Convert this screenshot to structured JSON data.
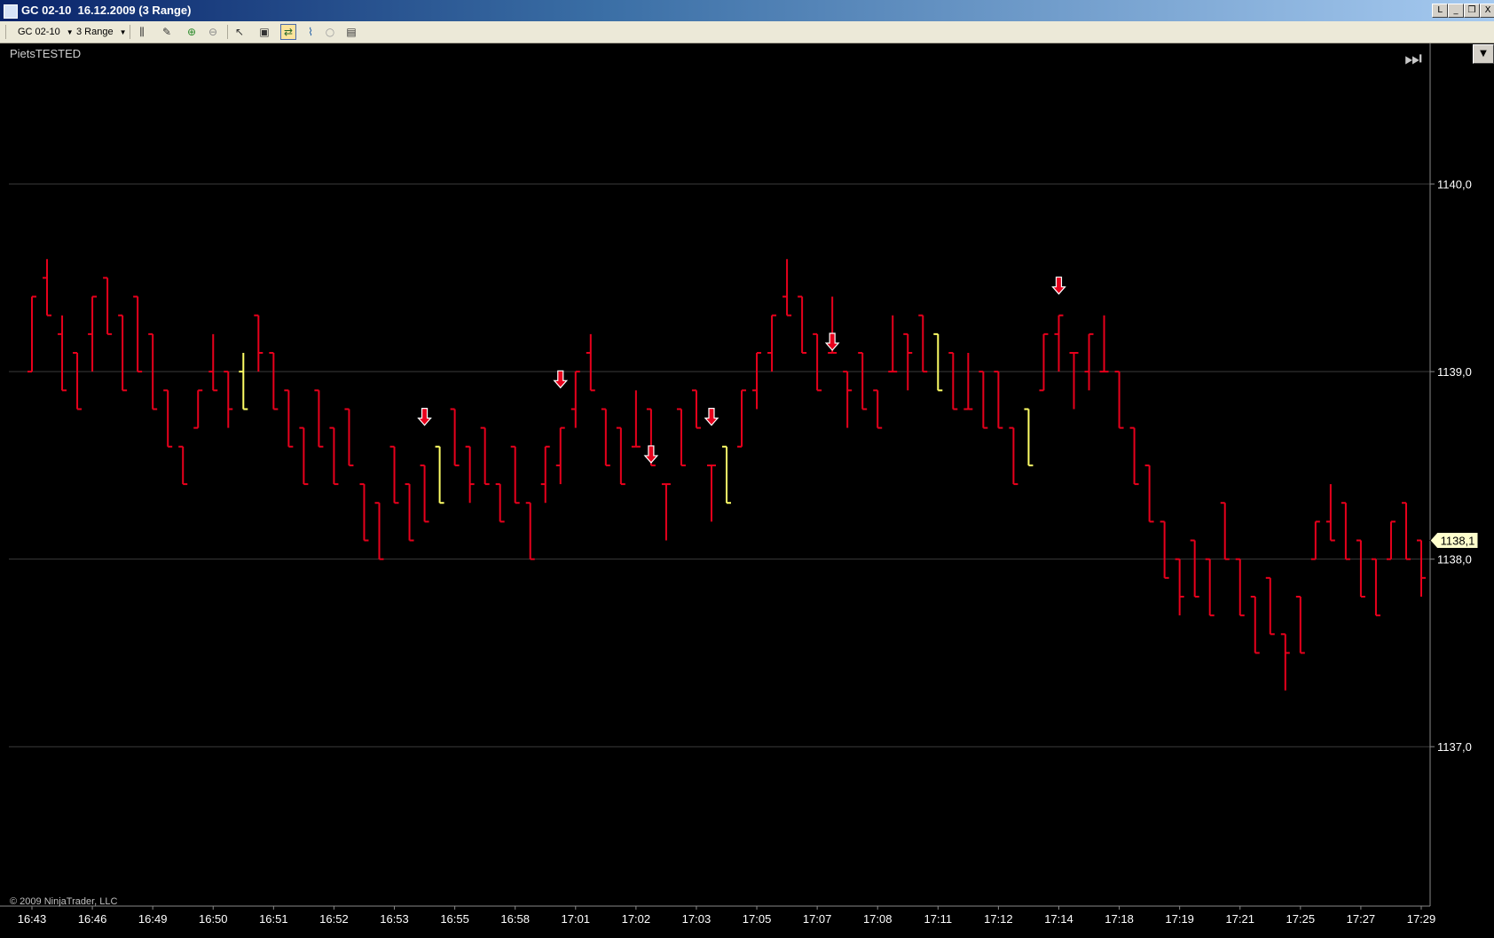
{
  "window": {
    "title": "GC 02-10  16.12.2009 (3 Range)",
    "buttons": [
      "L",
      "_",
      "❒",
      "X"
    ]
  },
  "toolbar": {
    "instrument": "GC 02-10",
    "interval": "3 Range",
    "icons": [
      "bar-style-icon",
      "drawing-tools-icon",
      "zoom-in-icon",
      "zoom-out-icon",
      "pointer-icon",
      "properties-icon",
      "strategies-icon",
      "indicators-icon",
      "data-box-icon",
      "chart-trader-icon"
    ]
  },
  "indicator_label": "PietsTESTED",
  "copyright": "© 2009 NinjaTrader, LLC",
  "colors": {
    "bar_down": "#e8001c",
    "bar_signal": "#ffff66",
    "grid": "#3a3a3a",
    "axis_text": "#ffffff",
    "price_marker_bg": "#ffffcc",
    "arrow_fill": "#e8001c"
  },
  "chart_data": {
    "type": "ohlc",
    "title": "",
    "xlabel": "",
    "ylabel": "",
    "ylim": [
      1136.15,
      1140.75
    ],
    "y_ticks": [
      1140.0,
      1139.0,
      1138.0,
      1137.0
    ],
    "y_tick_labels": [
      "1140,0",
      "1139,0",
      "1138,0",
      "1137,0"
    ],
    "last_price_label": "1138,1",
    "last_price": 1138.1,
    "x_tick_labels": [
      "16:43",
      "16:46",
      "16:49",
      "16:50",
      "16:51",
      "16:52",
      "16:53",
      "16:55",
      "16:58",
      "17:01",
      "17:02",
      "17:03",
      "17:05",
      "17:07",
      "17:08",
      "17:11",
      "17:12",
      "17:14",
      "17:18",
      "17:19",
      "17:21",
      "17:25",
      "17:27",
      "17:29"
    ],
    "grid": true,
    "bars": [
      {
        "o": 1139.0,
        "h": 1139.4,
        "l": 1139.0,
        "c": 1139.4,
        "color": "down"
      },
      {
        "o": 1139.5,
        "h": 1139.6,
        "l": 1139.3,
        "c": 1139.3,
        "color": "down"
      },
      {
        "o": 1139.2,
        "h": 1139.3,
        "l": 1138.9,
        "c": 1138.9,
        "color": "down"
      },
      {
        "o": 1139.1,
        "h": 1139.1,
        "l": 1138.8,
        "c": 1138.8,
        "color": "down"
      },
      {
        "o": 1139.2,
        "h": 1139.4,
        "l": 1139.0,
        "c": 1139.4,
        "color": "down"
      },
      {
        "o": 1139.5,
        "h": 1139.5,
        "l": 1139.2,
        "c": 1139.2,
        "color": "down"
      },
      {
        "o": 1139.3,
        "h": 1139.3,
        "l": 1138.9,
        "c": 1138.9,
        "color": "down"
      },
      {
        "o": 1139.4,
        "h": 1139.4,
        "l": 1139.0,
        "c": 1139.0,
        "color": "down"
      },
      {
        "o": 1139.2,
        "h": 1139.2,
        "l": 1138.8,
        "c": 1138.8,
        "color": "down"
      },
      {
        "o": 1138.9,
        "h": 1138.9,
        "l": 1138.6,
        "c": 1138.6,
        "color": "down"
      },
      {
        "o": 1138.6,
        "h": 1138.6,
        "l": 1138.4,
        "c": 1138.4,
        "color": "down"
      },
      {
        "o": 1138.7,
        "h": 1138.9,
        "l": 1138.7,
        "c": 1138.9,
        "color": "down"
      },
      {
        "o": 1139.0,
        "h": 1139.2,
        "l": 1138.9,
        "c": 1138.9,
        "color": "down"
      },
      {
        "o": 1139.0,
        "h": 1139.0,
        "l": 1138.7,
        "c": 1138.8,
        "color": "down"
      },
      {
        "o": 1139.0,
        "h": 1139.1,
        "l": 1138.8,
        "c": 1138.8,
        "color": "signal"
      },
      {
        "o": 1139.3,
        "h": 1139.3,
        "l": 1139.0,
        "c": 1139.1,
        "color": "down"
      },
      {
        "o": 1139.1,
        "h": 1139.1,
        "l": 1138.8,
        "c": 1138.8,
        "color": "down"
      },
      {
        "o": 1138.9,
        "h": 1138.9,
        "l": 1138.6,
        "c": 1138.6,
        "color": "down"
      },
      {
        "o": 1138.7,
        "h": 1138.7,
        "l": 1138.4,
        "c": 1138.4,
        "color": "down"
      },
      {
        "o": 1138.9,
        "h": 1138.9,
        "l": 1138.6,
        "c": 1138.6,
        "color": "down"
      },
      {
        "o": 1138.7,
        "h": 1138.7,
        "l": 1138.4,
        "c": 1138.4,
        "color": "down"
      },
      {
        "o": 1138.8,
        "h": 1138.8,
        "l": 1138.5,
        "c": 1138.5,
        "color": "down"
      },
      {
        "o": 1138.4,
        "h": 1138.4,
        "l": 1138.1,
        "c": 1138.1,
        "color": "down"
      },
      {
        "o": 1138.3,
        "h": 1138.3,
        "l": 1138.0,
        "c": 1138.0,
        "color": "down"
      },
      {
        "o": 1138.6,
        "h": 1138.6,
        "l": 1138.3,
        "c": 1138.3,
        "color": "down"
      },
      {
        "o": 1138.4,
        "h": 1138.4,
        "l": 1138.1,
        "c": 1138.1,
        "color": "down"
      },
      {
        "o": 1138.5,
        "h": 1138.5,
        "l": 1138.2,
        "c": 1138.2,
        "color": "down"
      },
      {
        "o": 1138.6,
        "h": 1138.6,
        "l": 1138.3,
        "c": 1138.3,
        "color": "signal"
      },
      {
        "o": 1138.8,
        "h": 1138.8,
        "l": 1138.5,
        "c": 1138.5,
        "color": "down"
      },
      {
        "o": 1138.6,
        "h": 1138.6,
        "l": 1138.3,
        "c": 1138.4,
        "color": "down"
      },
      {
        "o": 1138.7,
        "h": 1138.7,
        "l": 1138.4,
        "c": 1138.4,
        "color": "down"
      },
      {
        "o": 1138.4,
        "h": 1138.4,
        "l": 1138.2,
        "c": 1138.2,
        "color": "down"
      },
      {
        "o": 1138.6,
        "h": 1138.6,
        "l": 1138.3,
        "c": 1138.3,
        "color": "down"
      },
      {
        "o": 1138.3,
        "h": 1138.3,
        "l": 1138.0,
        "c": 1138.0,
        "color": "down"
      },
      {
        "o": 1138.4,
        "h": 1138.6,
        "l": 1138.3,
        "c": 1138.6,
        "color": "down"
      },
      {
        "o": 1138.5,
        "h": 1138.7,
        "l": 1138.4,
        "c": 1138.7,
        "color": "down"
      },
      {
        "o": 1138.8,
        "h": 1139.0,
        "l": 1138.7,
        "c": 1139.0,
        "color": "down"
      },
      {
        "o": 1139.1,
        "h": 1139.2,
        "l": 1138.9,
        "c": 1138.9,
        "color": "down"
      },
      {
        "o": 1138.8,
        "h": 1138.8,
        "l": 1138.5,
        "c": 1138.5,
        "color": "down"
      },
      {
        "o": 1138.7,
        "h": 1138.7,
        "l": 1138.4,
        "c": 1138.4,
        "color": "down"
      },
      {
        "o": 1138.6,
        "h": 1138.9,
        "l": 1138.6,
        "c": 1138.6,
        "color": "down"
      },
      {
        "o": 1138.8,
        "h": 1138.8,
        "l": 1138.5,
        "c": 1138.5,
        "color": "down"
      },
      {
        "o": 1138.4,
        "h": 1138.4,
        "l": 1138.1,
        "c": 1138.4,
        "color": "down"
      },
      {
        "o": 1138.8,
        "h": 1138.8,
        "l": 1138.5,
        "c": 1138.5,
        "color": "down"
      },
      {
        "o": 1138.9,
        "h": 1138.9,
        "l": 1138.7,
        "c": 1138.7,
        "color": "down"
      },
      {
        "o": 1138.5,
        "h": 1138.5,
        "l": 1138.2,
        "c": 1138.5,
        "color": "down"
      },
      {
        "o": 1138.6,
        "h": 1138.6,
        "l": 1138.3,
        "c": 1138.3,
        "color": "signal"
      },
      {
        "o": 1138.6,
        "h": 1138.9,
        "l": 1138.6,
        "c": 1138.9,
        "color": "down"
      },
      {
        "o": 1138.9,
        "h": 1139.1,
        "l": 1138.8,
        "c": 1139.1,
        "color": "down"
      },
      {
        "o": 1139.1,
        "h": 1139.3,
        "l": 1139.0,
        "c": 1139.3,
        "color": "down"
      },
      {
        "o": 1139.4,
        "h": 1139.6,
        "l": 1139.3,
        "c": 1139.3,
        "color": "down"
      },
      {
        "o": 1139.4,
        "h": 1139.4,
        "l": 1139.1,
        "c": 1139.1,
        "color": "down"
      },
      {
        "o": 1139.2,
        "h": 1139.2,
        "l": 1138.9,
        "c": 1138.9,
        "color": "down"
      },
      {
        "o": 1139.1,
        "h": 1139.4,
        "l": 1139.1,
        "c": 1139.1,
        "color": "down"
      },
      {
        "o": 1139.0,
        "h": 1139.0,
        "l": 1138.7,
        "c": 1138.9,
        "color": "down"
      },
      {
        "o": 1139.1,
        "h": 1139.1,
        "l": 1138.8,
        "c": 1138.8,
        "color": "down"
      },
      {
        "o": 1138.9,
        "h": 1138.9,
        "l": 1138.7,
        "c": 1138.7,
        "color": "down"
      },
      {
        "o": 1139.0,
        "h": 1139.3,
        "l": 1139.0,
        "c": 1139.0,
        "color": "down"
      },
      {
        "o": 1139.2,
        "h": 1139.2,
        "l": 1138.9,
        "c": 1139.1,
        "color": "down"
      },
      {
        "o": 1139.3,
        "h": 1139.3,
        "l": 1139.0,
        "c": 1139.0,
        "color": "down"
      },
      {
        "o": 1139.2,
        "h": 1139.2,
        "l": 1138.9,
        "c": 1138.9,
        "color": "signal"
      },
      {
        "o": 1139.1,
        "h": 1139.1,
        "l": 1138.8,
        "c": 1138.8,
        "color": "down"
      },
      {
        "o": 1138.8,
        "h": 1139.1,
        "l": 1138.8,
        "c": 1138.8,
        "color": "down"
      },
      {
        "o": 1139.0,
        "h": 1139.0,
        "l": 1138.7,
        "c": 1138.7,
        "color": "down"
      },
      {
        "o": 1139.0,
        "h": 1139.0,
        "l": 1138.7,
        "c": 1138.7,
        "color": "down"
      },
      {
        "o": 1138.7,
        "h": 1138.7,
        "l": 1138.4,
        "c": 1138.4,
        "color": "down"
      },
      {
        "o": 1138.8,
        "h": 1138.8,
        "l": 1138.5,
        "c": 1138.5,
        "color": "signal"
      },
      {
        "o": 1138.9,
        "h": 1139.2,
        "l": 1138.9,
        "c": 1139.2,
        "color": "down"
      },
      {
        "o": 1139.2,
        "h": 1139.3,
        "l": 1139.0,
        "c": 1139.3,
        "color": "down"
      },
      {
        "o": 1139.1,
        "h": 1139.1,
        "l": 1138.8,
        "c": 1139.1,
        "color": "down"
      },
      {
        "o": 1139.0,
        "h": 1139.2,
        "l": 1138.9,
        "c": 1139.2,
        "color": "down"
      },
      {
        "o": 1139.0,
        "h": 1139.3,
        "l": 1139.0,
        "c": 1139.0,
        "color": "down"
      },
      {
        "o": 1139.0,
        "h": 1139.0,
        "l": 1138.7,
        "c": 1138.7,
        "color": "down"
      },
      {
        "o": 1138.7,
        "h": 1138.7,
        "l": 1138.4,
        "c": 1138.4,
        "color": "down"
      },
      {
        "o": 1138.5,
        "h": 1138.5,
        "l": 1138.2,
        "c": 1138.2,
        "color": "down"
      },
      {
        "o": 1138.2,
        "h": 1138.2,
        "l": 1137.9,
        "c": 1137.9,
        "color": "down"
      },
      {
        "o": 1138.0,
        "h": 1138.0,
        "l": 1137.7,
        "c": 1137.8,
        "color": "down"
      },
      {
        "o": 1138.1,
        "h": 1138.1,
        "l": 1137.8,
        "c": 1137.8,
        "color": "down"
      },
      {
        "o": 1138.0,
        "h": 1138.0,
        "l": 1137.7,
        "c": 1137.7,
        "color": "down"
      },
      {
        "o": 1138.3,
        "h": 1138.3,
        "l": 1138.0,
        "c": 1138.0,
        "color": "down"
      },
      {
        "o": 1138.0,
        "h": 1138.0,
        "l": 1137.7,
        "c": 1137.7,
        "color": "down"
      },
      {
        "o": 1137.8,
        "h": 1137.8,
        "l": 1137.5,
        "c": 1137.5,
        "color": "down"
      },
      {
        "o": 1137.9,
        "h": 1137.9,
        "l": 1137.6,
        "c": 1137.6,
        "color": "down"
      },
      {
        "o": 1137.6,
        "h": 1137.6,
        "l": 1137.3,
        "c": 1137.5,
        "color": "down"
      },
      {
        "o": 1137.8,
        "h": 1137.8,
        "l": 1137.5,
        "c": 1137.5,
        "color": "down"
      },
      {
        "o": 1138.0,
        "h": 1138.2,
        "l": 1138.0,
        "c": 1138.2,
        "color": "down"
      },
      {
        "o": 1138.2,
        "h": 1138.4,
        "l": 1138.1,
        "c": 1138.1,
        "color": "down"
      },
      {
        "o": 1138.3,
        "h": 1138.3,
        "l": 1138.0,
        "c": 1138.0,
        "color": "down"
      },
      {
        "o": 1138.1,
        "h": 1138.1,
        "l": 1137.8,
        "c": 1137.8,
        "color": "down"
      },
      {
        "o": 1138.0,
        "h": 1138.0,
        "l": 1137.7,
        "c": 1137.7,
        "color": "down"
      },
      {
        "o": 1138.0,
        "h": 1138.2,
        "l": 1138.0,
        "c": 1138.2,
        "color": "down"
      },
      {
        "o": 1138.3,
        "h": 1138.3,
        "l": 1138.0,
        "c": 1138.0,
        "color": "down"
      },
      {
        "o": 1138.1,
        "h": 1138.1,
        "l": 1137.8,
        "c": 1137.9,
        "color": "down"
      }
    ],
    "short_signals": [
      {
        "bar": 26,
        "price": 1138.7
      },
      {
        "bar": 35,
        "price": 1138.9
      },
      {
        "bar": 41,
        "price": 1138.5
      },
      {
        "bar": 45,
        "price": 1138.7
      },
      {
        "bar": 53,
        "price": 1139.1
      },
      {
        "bar": 68,
        "price": 1139.4
      }
    ]
  }
}
